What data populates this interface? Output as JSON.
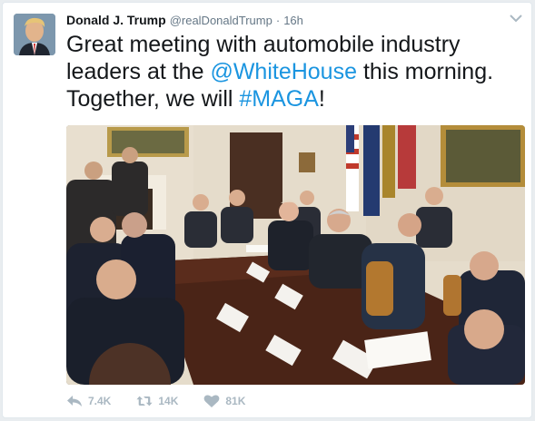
{
  "tweet": {
    "author_name": "Donald J. Trump",
    "handle": "@realDonaldTrump",
    "separator": "·",
    "time": "16h",
    "text_1": "Great meeting with automobile industry leaders at the ",
    "mention": "@WhiteHouse",
    "text_2": " this morning. Together, we will ",
    "hashtag": "#MAGA",
    "text_3": "!"
  },
  "actions": {
    "reply_count": "7.4K",
    "retweet_count": "14K",
    "like_count": "81K"
  },
  "colors": {
    "link": "#1b95e0",
    "text": "#14171a",
    "muted": "#657786",
    "action": "#aab8c2"
  },
  "icons": [
    "chevron-down-icon",
    "reply-icon",
    "retweet-icon",
    "heart-icon"
  ]
}
